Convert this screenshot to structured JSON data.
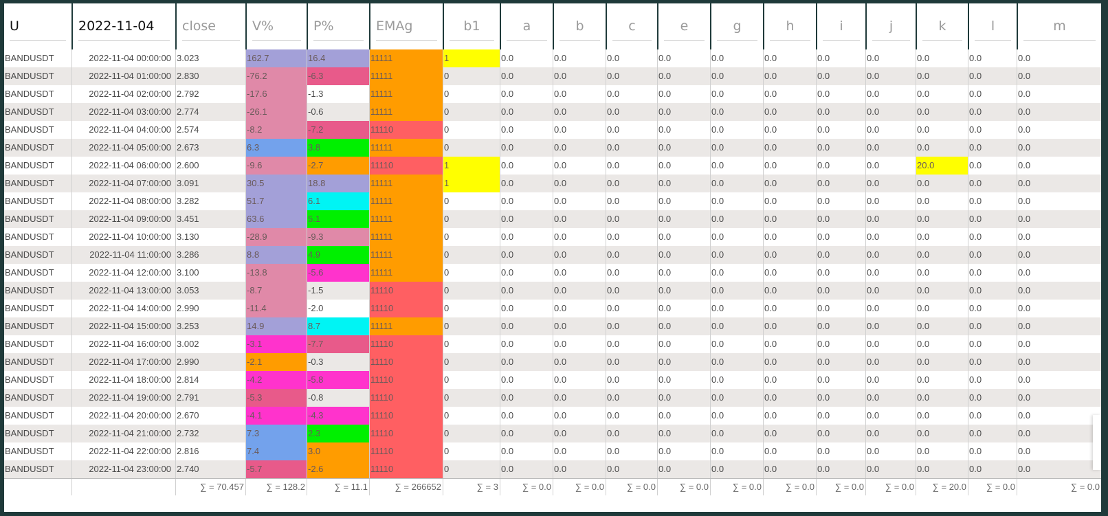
{
  "header": {
    "symbol_filter": "U",
    "date_filter": "2022-11-04",
    "columns": [
      "close",
      "V%",
      "P%",
      "EMAg",
      "b1",
      "a",
      "b",
      "c",
      "e",
      "g",
      "h",
      "i",
      "j",
      "k",
      "l",
      "m"
    ]
  },
  "colors": {
    "purple": "#a3a0d8",
    "pink": "#e089a8",
    "red_pink": "#e85a8a",
    "magenta": "#ff33cc",
    "blue": "#73a2ec",
    "green": "#00f000",
    "cyan": "#00f4f4",
    "orange": "#ff9c00",
    "coral": "#ff5f62",
    "yellow": "#ffff00"
  },
  "rows": [
    {
      "symbol": "BANDUSDT",
      "time": "2022-11-04 00:00:00",
      "close": "3.023",
      "v": "162.7",
      "p": "16.4",
      "ema": "11111",
      "b1": "1",
      "a": "0.0",
      "b": "0.0",
      "c": "0.0",
      "e": "0.0",
      "g": "0.0",
      "h": "0.0",
      "i": "0.0",
      "j": "0.0",
      "k": "0.0",
      "l": "0.0",
      "m": "0.0",
      "vc": "purple",
      "pc": "purple",
      "ec": "orange",
      "b1c": "yellow",
      "kc": ""
    },
    {
      "symbol": "BANDUSDT",
      "time": "2022-11-04 01:00:00",
      "close": "2.830",
      "v": "-76.2",
      "p": "-6.3",
      "ema": "11111",
      "b1": "0",
      "a": "0.0",
      "b": "0.0",
      "c": "0.0",
      "e": "0.0",
      "g": "0.0",
      "h": "0.0",
      "i": "0.0",
      "j": "0.0",
      "k": "0.0",
      "l": "0.0",
      "m": "0.0",
      "vc": "pink",
      "pc": "red_pink",
      "ec": "orange",
      "b1c": "",
      "kc": ""
    },
    {
      "symbol": "BANDUSDT",
      "time": "2022-11-04 02:00:00",
      "close": "2.792",
      "v": "-17.6",
      "p": "-1.3",
      "ema": "11111",
      "b1": "0",
      "a": "0.0",
      "b": "0.0",
      "c": "0.0",
      "e": "0.0",
      "g": "0.0",
      "h": "0.0",
      "i": "0.0",
      "j": "0.0",
      "k": "0.0",
      "l": "0.0",
      "m": "0.0",
      "vc": "pink",
      "pc": "",
      "ec": "orange",
      "b1c": "",
      "kc": ""
    },
    {
      "symbol": "BANDUSDT",
      "time": "2022-11-04 03:00:00",
      "close": "2.774",
      "v": "-26.1",
      "p": "-0.6",
      "ema": "11111",
      "b1": "0",
      "a": "0.0",
      "b": "0.0",
      "c": "0.0",
      "e": "0.0",
      "g": "0.0",
      "h": "0.0",
      "i": "0.0",
      "j": "0.0",
      "k": "0.0",
      "l": "0.0",
      "m": "0.0",
      "vc": "pink",
      "pc": "",
      "ec": "orange",
      "b1c": "",
      "kc": ""
    },
    {
      "symbol": "BANDUSDT",
      "time": "2022-11-04 04:00:00",
      "close": "2.574",
      "v": "-8.2",
      "p": "-7.2",
      "ema": "11110",
      "b1": "0",
      "a": "0.0",
      "b": "0.0",
      "c": "0.0",
      "e": "0.0",
      "g": "0.0",
      "h": "0.0",
      "i": "0.0",
      "j": "0.0",
      "k": "0.0",
      "l": "0.0",
      "m": "0.0",
      "vc": "pink",
      "pc": "red_pink",
      "ec": "coral",
      "b1c": "",
      "kc": ""
    },
    {
      "symbol": "BANDUSDT",
      "time": "2022-11-04 05:00:00",
      "close": "2.673",
      "v": "6.3",
      "p": "3.8",
      "ema": "11111",
      "b1": "0",
      "a": "0.0",
      "b": "0.0",
      "c": "0.0",
      "e": "0.0",
      "g": "0.0",
      "h": "0.0",
      "i": "0.0",
      "j": "0.0",
      "k": "0.0",
      "l": "0.0",
      "m": "0.0",
      "vc": "blue",
      "pc": "green",
      "ec": "orange",
      "b1c": "",
      "kc": ""
    },
    {
      "symbol": "BANDUSDT",
      "time": "2022-11-04 06:00:00",
      "close": "2.600",
      "v": "-9.6",
      "p": "-2.7",
      "ema": "11110",
      "b1": "1",
      "a": "0.0",
      "b": "0.0",
      "c": "0.0",
      "e": "0.0",
      "g": "0.0",
      "h": "0.0",
      "i": "0.0",
      "j": "0.0",
      "k": "20.0",
      "l": "0.0",
      "m": "0.0",
      "vc": "pink",
      "pc": "orange",
      "ec": "coral",
      "b1c": "yellow",
      "kc": "yellow"
    },
    {
      "symbol": "BANDUSDT",
      "time": "2022-11-04 07:00:00",
      "close": "3.091",
      "v": "30.5",
      "p": "18.8",
      "ema": "11111",
      "b1": "1",
      "a": "0.0",
      "b": "0.0",
      "c": "0.0",
      "e": "0.0",
      "g": "0.0",
      "h": "0.0",
      "i": "0.0",
      "j": "0.0",
      "k": "0.0",
      "l": "0.0",
      "m": "0.0",
      "vc": "purple",
      "pc": "purple",
      "ec": "orange",
      "b1c": "yellow",
      "kc": ""
    },
    {
      "symbol": "BANDUSDT",
      "time": "2022-11-04 08:00:00",
      "close": "3.282",
      "v": "51.7",
      "p": "6.1",
      "ema": "11111",
      "b1": "0",
      "a": "0.0",
      "b": "0.0",
      "c": "0.0",
      "e": "0.0",
      "g": "0.0",
      "h": "0.0",
      "i": "0.0",
      "j": "0.0",
      "k": "0.0",
      "l": "0.0",
      "m": "0.0",
      "vc": "purple",
      "pc": "cyan",
      "ec": "orange",
      "b1c": "",
      "kc": ""
    },
    {
      "symbol": "BANDUSDT",
      "time": "2022-11-04 09:00:00",
      "close": "3.451",
      "v": "63.6",
      "p": "5.1",
      "ema": "11111",
      "b1": "0",
      "a": "0.0",
      "b": "0.0",
      "c": "0.0",
      "e": "0.0",
      "g": "0.0",
      "h": "0.0",
      "i": "0.0",
      "j": "0.0",
      "k": "0.0",
      "l": "0.0",
      "m": "0.0",
      "vc": "purple",
      "pc": "green",
      "ec": "orange",
      "b1c": "",
      "kc": ""
    },
    {
      "symbol": "BANDUSDT",
      "time": "2022-11-04 10:00:00",
      "close": "3.130",
      "v": "-28.9",
      "p": "-9.3",
      "ema": "11111",
      "b1": "0",
      "a": "0.0",
      "b": "0.0",
      "c": "0.0",
      "e": "0.0",
      "g": "0.0",
      "h": "0.0",
      "i": "0.0",
      "j": "0.0",
      "k": "0.0",
      "l": "0.0",
      "m": "0.0",
      "vc": "pink",
      "pc": "pink",
      "ec": "orange",
      "b1c": "",
      "kc": ""
    },
    {
      "symbol": "BANDUSDT",
      "time": "2022-11-04 11:00:00",
      "close": "3.286",
      "v": "8.8",
      "p": "4.9",
      "ema": "11111",
      "b1": "0",
      "a": "0.0",
      "b": "0.0",
      "c": "0.0",
      "e": "0.0",
      "g": "0.0",
      "h": "0.0",
      "i": "0.0",
      "j": "0.0",
      "k": "0.0",
      "l": "0.0",
      "m": "0.0",
      "vc": "purple",
      "pc": "green",
      "ec": "orange",
      "b1c": "",
      "kc": ""
    },
    {
      "symbol": "BANDUSDT",
      "time": "2022-11-04 12:00:00",
      "close": "3.100",
      "v": "-13.8",
      "p": "-5.6",
      "ema": "11111",
      "b1": "0",
      "a": "0.0",
      "b": "0.0",
      "c": "0.0",
      "e": "0.0",
      "g": "0.0",
      "h": "0.0",
      "i": "0.0",
      "j": "0.0",
      "k": "0.0",
      "l": "0.0",
      "m": "0.0",
      "vc": "pink",
      "pc": "magenta",
      "ec": "orange",
      "b1c": "",
      "kc": ""
    },
    {
      "symbol": "BANDUSDT",
      "time": "2022-11-04 13:00:00",
      "close": "3.053",
      "v": "-8.7",
      "p": "-1.5",
      "ema": "11110",
      "b1": "0",
      "a": "0.0",
      "b": "0.0",
      "c": "0.0",
      "e": "0.0",
      "g": "0.0",
      "h": "0.0",
      "i": "0.0",
      "j": "0.0",
      "k": "0.0",
      "l": "0.0",
      "m": "0.0",
      "vc": "pink",
      "pc": "",
      "ec": "coral",
      "b1c": "",
      "kc": ""
    },
    {
      "symbol": "BANDUSDT",
      "time": "2022-11-04 14:00:00",
      "close": "2.990",
      "v": "-11.4",
      "p": "-2.0",
      "ema": "11110",
      "b1": "0",
      "a": "0.0",
      "b": "0.0",
      "c": "0.0",
      "e": "0.0",
      "g": "0.0",
      "h": "0.0",
      "i": "0.0",
      "j": "0.0",
      "k": "0.0",
      "l": "0.0",
      "m": "0.0",
      "vc": "pink",
      "pc": "",
      "ec": "coral",
      "b1c": "",
      "kc": ""
    },
    {
      "symbol": "BANDUSDT",
      "time": "2022-11-04 15:00:00",
      "close": "3.253",
      "v": "14.9",
      "p": "8.7",
      "ema": "11111",
      "b1": "0",
      "a": "0.0",
      "b": "0.0",
      "c": "0.0",
      "e": "0.0",
      "g": "0.0",
      "h": "0.0",
      "i": "0.0",
      "j": "0.0",
      "k": "0.0",
      "l": "0.0",
      "m": "0.0",
      "vc": "purple",
      "pc": "cyan",
      "ec": "orange",
      "b1c": "",
      "kc": ""
    },
    {
      "symbol": "BANDUSDT",
      "time": "2022-11-04 16:00:00",
      "close": "3.002",
      "v": "-3.1",
      "p": "-7.7",
      "ema": "11110",
      "b1": "0",
      "a": "0.0",
      "b": "0.0",
      "c": "0.0",
      "e": "0.0",
      "g": "0.0",
      "h": "0.0",
      "i": "0.0",
      "j": "0.0",
      "k": "0.0",
      "l": "0.0",
      "m": "0.0",
      "vc": "magenta",
      "pc": "red_pink",
      "ec": "coral",
      "b1c": "",
      "kc": ""
    },
    {
      "symbol": "BANDUSDT",
      "time": "2022-11-04 17:00:00",
      "close": "2.990",
      "v": "-2.1",
      "p": "-0.3",
      "ema": "11110",
      "b1": "0",
      "a": "0.0",
      "b": "0.0",
      "c": "0.0",
      "e": "0.0",
      "g": "0.0",
      "h": "0.0",
      "i": "0.0",
      "j": "0.0",
      "k": "0.0",
      "l": "0.0",
      "m": "0.0",
      "vc": "orange",
      "pc": "",
      "ec": "coral",
      "b1c": "",
      "kc": ""
    },
    {
      "symbol": "BANDUSDT",
      "time": "2022-11-04 18:00:00",
      "close": "2.814",
      "v": "-4.2",
      "p": "-5.8",
      "ema": "11110",
      "b1": "0",
      "a": "0.0",
      "b": "0.0",
      "c": "0.0",
      "e": "0.0",
      "g": "0.0",
      "h": "0.0",
      "i": "0.0",
      "j": "0.0",
      "k": "0.0",
      "l": "0.0",
      "m": "0.0",
      "vc": "magenta",
      "pc": "magenta",
      "ec": "coral",
      "b1c": "",
      "kc": ""
    },
    {
      "symbol": "BANDUSDT",
      "time": "2022-11-04 19:00:00",
      "close": "2.791",
      "v": "-5.3",
      "p": "-0.8",
      "ema": "11110",
      "b1": "0",
      "a": "0.0",
      "b": "0.0",
      "c": "0.0",
      "e": "0.0",
      "g": "0.0",
      "h": "0.0",
      "i": "0.0",
      "j": "0.0",
      "k": "0.0",
      "l": "0.0",
      "m": "0.0",
      "vc": "red_pink",
      "pc": "",
      "ec": "coral",
      "b1c": "",
      "kc": ""
    },
    {
      "symbol": "BANDUSDT",
      "time": "2022-11-04 20:00:00",
      "close": "2.670",
      "v": "-4.1",
      "p": "-4.3",
      "ema": "11110",
      "b1": "0",
      "a": "0.0",
      "b": "0.0",
      "c": "0.0",
      "e": "0.0",
      "g": "0.0",
      "h": "0.0",
      "i": "0.0",
      "j": "0.0",
      "k": "0.0",
      "l": "0.0",
      "m": "0.0",
      "vc": "magenta",
      "pc": "magenta",
      "ec": "coral",
      "b1c": "",
      "kc": ""
    },
    {
      "symbol": "BANDUSDT",
      "time": "2022-11-04 21:00:00",
      "close": "2.732",
      "v": "7.3",
      "p": "2.3",
      "ema": "11110",
      "b1": "0",
      "a": "0.0",
      "b": "0.0",
      "c": "0.0",
      "e": "0.0",
      "g": "0.0",
      "h": "0.0",
      "i": "0.0",
      "j": "0.0",
      "k": "0.0",
      "l": "0.0",
      "m": "0.0",
      "vc": "blue",
      "pc": "green",
      "ec": "coral",
      "b1c": "",
      "kc": ""
    },
    {
      "symbol": "BANDUSDT",
      "time": "2022-11-04 22:00:00",
      "close": "2.816",
      "v": "7.4",
      "p": "3.0",
      "ema": "11110",
      "b1": "0",
      "a": "0.0",
      "b": "0.0",
      "c": "0.0",
      "e": "0.0",
      "g": "0.0",
      "h": "0.0",
      "i": "0.0",
      "j": "0.0",
      "k": "0.0",
      "l": "0.0",
      "m": "0.0",
      "vc": "blue",
      "pc": "orange",
      "ec": "coral",
      "b1c": "",
      "kc": ""
    },
    {
      "symbol": "BANDUSDT",
      "time": "2022-11-04 23:00:00",
      "close": "2.740",
      "v": "-5.7",
      "p": "-2.6",
      "ema": "11110",
      "b1": "0",
      "a": "0.0",
      "b": "0.0",
      "c": "0.0",
      "e": "0.0",
      "g": "0.0",
      "h": "0.0",
      "i": "0.0",
      "j": "0.0",
      "k": "0.0",
      "l": "0.0",
      "m": "0.0",
      "vc": "red_pink",
      "pc": "orange",
      "ec": "coral",
      "b1c": "",
      "kc": ""
    }
  ],
  "sums": [
    "∑ = 70.457",
    "∑ = 128.2",
    "∑ = 11.1",
    "∑ = 266652",
    "∑ = 3",
    "∑ = 0.0",
    "∑ = 0.0",
    "∑ = 0.0",
    "∑ = 0.0",
    "∑ = 0.0",
    "∑ = 0.0",
    "∑ = 0.0",
    "∑ = 0.0",
    "∑ = 20.0",
    "∑ = 0.0",
    "∑ = 0.0"
  ]
}
